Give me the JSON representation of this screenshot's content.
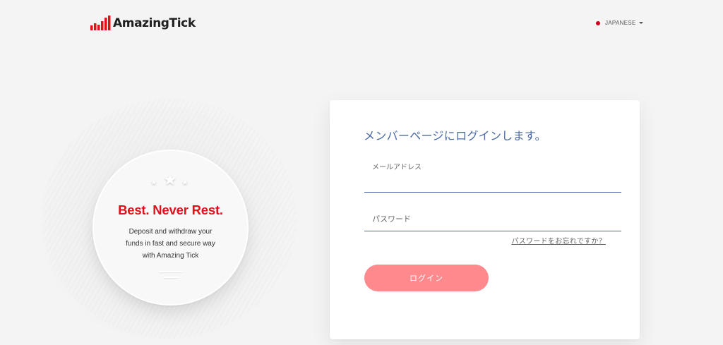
{
  "brand": {
    "name": "AmazingTick",
    "accent": "#e1101a"
  },
  "header": {
    "language_label": "JAPANESE",
    "flag_color": "#d4001f"
  },
  "promo": {
    "title": "Best. Never Rest.",
    "line1": "Deposit and withdraw your",
    "line2": "funds in fast and secure way",
    "line3": "with Amazing Tick"
  },
  "login": {
    "title": "メンバーページにログインします。",
    "email_label": "メールアドレス",
    "email_value": "",
    "password_placeholder": "パスワード",
    "password_value": "",
    "forgot_link": "パスワードをお忘れですか？",
    "submit_label": "ログイン",
    "title_color": "#4a6aa5",
    "button_color": "#ff8a8d"
  },
  "icons": [
    "logo-bars-icon",
    "flag-dot-icon",
    "caret-down-icon",
    "star-icon"
  ]
}
